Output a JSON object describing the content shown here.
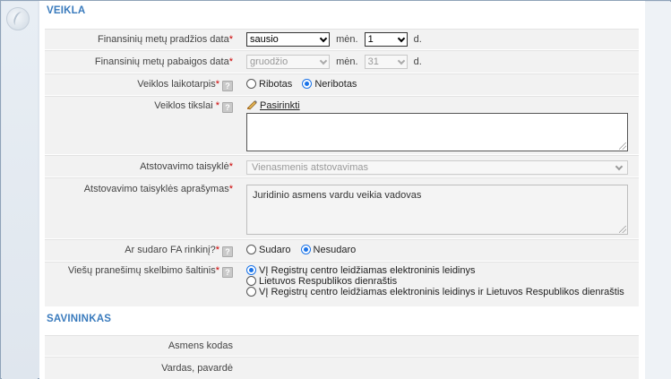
{
  "sections": {
    "veikla_title": "VEIKLA",
    "savininkas_title": "SAVININKAS"
  },
  "fiscal_start": {
    "label": "Finansinių metų pradžios data",
    "month_value": "sausio",
    "month_unit": "mėn.",
    "day_value": "1",
    "day_unit": "d."
  },
  "fiscal_end": {
    "label": "Finansinių metų pabaigos data",
    "month_value": "gruodžio",
    "month_unit": "mėn.",
    "day_value": "31",
    "day_unit": "d."
  },
  "period": {
    "label": "Veiklos laikotarpis",
    "options": [
      "Ribotas",
      "Neribotas"
    ],
    "selected": "Neribotas"
  },
  "goals": {
    "label": "Veiklos tikslai ",
    "select_link": "Pasirinkti",
    "text": ""
  },
  "representation_rule": {
    "label": "Atstovavimo taisyklė",
    "value": "Vienasmenis atstovavimas"
  },
  "representation_desc": {
    "label": "Atstovavimo taisyklės aprašymas",
    "text": "Juridinio asmens vardu veikia vadovas"
  },
  "fa_set": {
    "label": "Ar sudaro FA rinkinį?",
    "options": [
      "Sudaro",
      "Nesudaro"
    ],
    "selected": "Nesudaro"
  },
  "publication_source": {
    "label": "Viešų pranešimų skelbimo šaltinis",
    "options": [
      "VĮ Registrų centro leidžiamas elektroninis leidinys",
      "Lietuvos Respublikos dienraštis",
      "VĮ Registrų centro leidžiamas elektroninis leidinys ir Lietuvos Respublikos dienraštis"
    ],
    "selected_index": 0
  },
  "owner": {
    "code_label": "Asmens kodas",
    "name_label": "Vardas, pavardė"
  },
  "icons": {
    "help": "help-icon",
    "pencil": "pencil-icon"
  },
  "colors": {
    "section_title": "#3a7bbd",
    "required": "#cc0000",
    "radio_on": "#1a73e8"
  }
}
